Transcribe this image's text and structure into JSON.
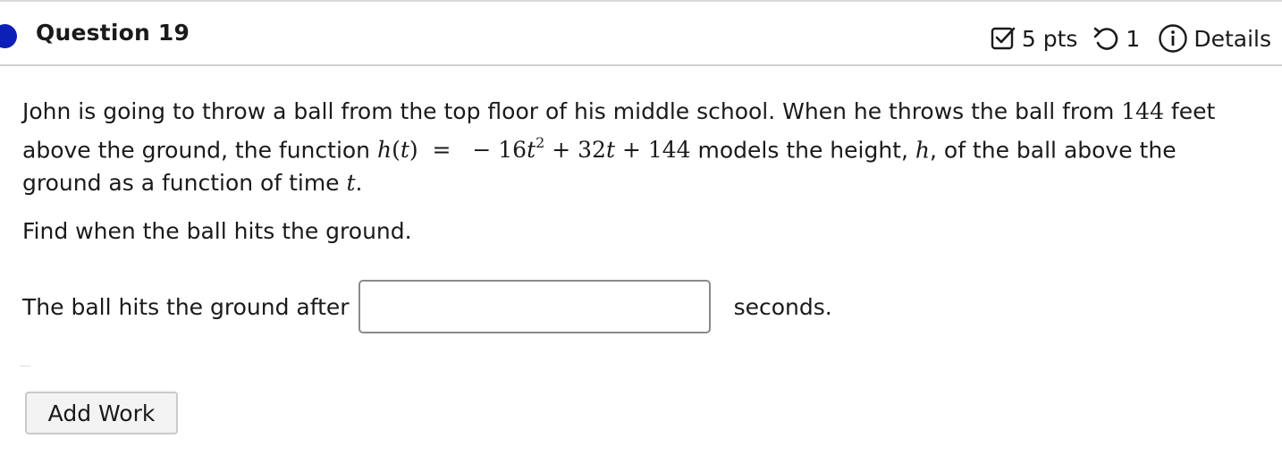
{
  "question": {
    "title": "Question 19",
    "points": "5 pts",
    "attempts": "1",
    "details_label": "Details"
  },
  "prompt": {
    "line1": "John is going to throw a ball from the top floor of his middle school. When he throws the ball from ",
    "feet_value": "144",
    "line1_end": " feet",
    "line2_start": "above the ground, the function ",
    "fn_h": "h",
    "fn_t": "t",
    "eq_rhs_a": "16",
    "eq_rhs_exp": "2",
    "eq_rhs_b": "32",
    "eq_rhs_c": "144",
    "line2_end": " models the height, ",
    "var_h": "h",
    "line2_tail": ", of the ball above the",
    "line3": "ground as a function of time ",
    "var_t": "t",
    "line3_end": "."
  },
  "find_text": "Find when the ball hits the ground.",
  "answer": {
    "prefix": "The ball hits the ground after",
    "value": "",
    "placeholder": "",
    "suffix": "seconds."
  },
  "add_work_label": "Add Work",
  "colors": {
    "status_dot": "#0c20b8",
    "divider": "#d0d0d0",
    "button_bg": "#f3f3f3"
  },
  "icons": {
    "points": "checkbox-icon",
    "attempts": "retry-icon",
    "details": "info-icon"
  }
}
